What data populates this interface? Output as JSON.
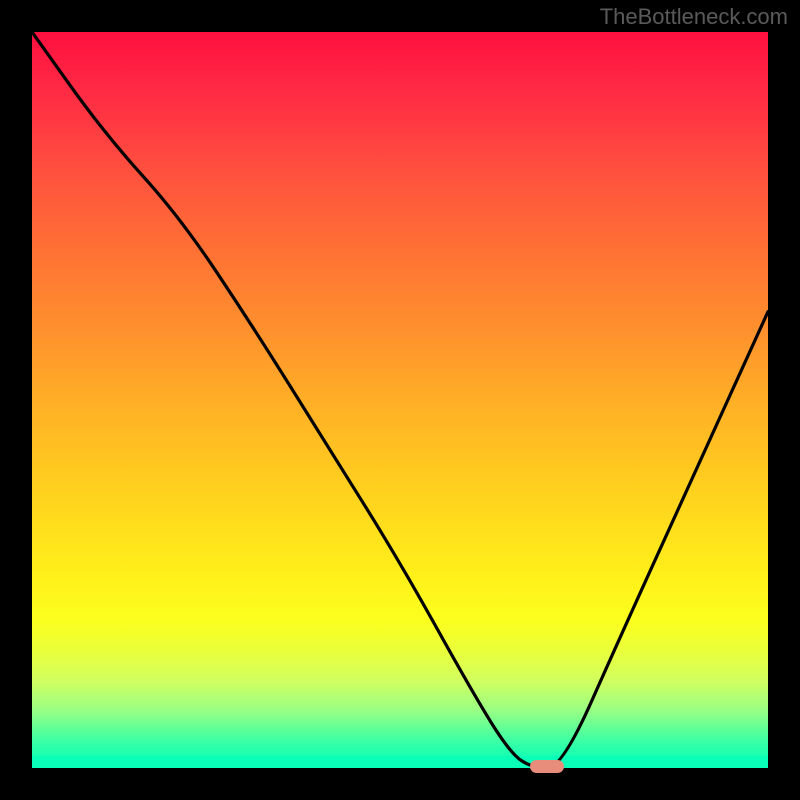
{
  "watermark": "TheBottleneck.com",
  "chart_data": {
    "type": "line",
    "title": "",
    "xlabel": "",
    "ylabel": "",
    "xlim": [
      0,
      100
    ],
    "ylim": [
      0,
      100
    ],
    "x": [
      0,
      10,
      20,
      30,
      40,
      50,
      60,
      65,
      68,
      72,
      80,
      90,
      100
    ],
    "values": [
      100,
      86,
      75,
      60,
      44,
      28,
      10,
      2,
      0,
      0,
      18,
      40,
      62
    ],
    "marker": {
      "x": 70,
      "y": 0
    },
    "background_gradient": {
      "top": "#ff103f",
      "mid": "#ffd01e",
      "bottom": "#09ffb8"
    }
  }
}
